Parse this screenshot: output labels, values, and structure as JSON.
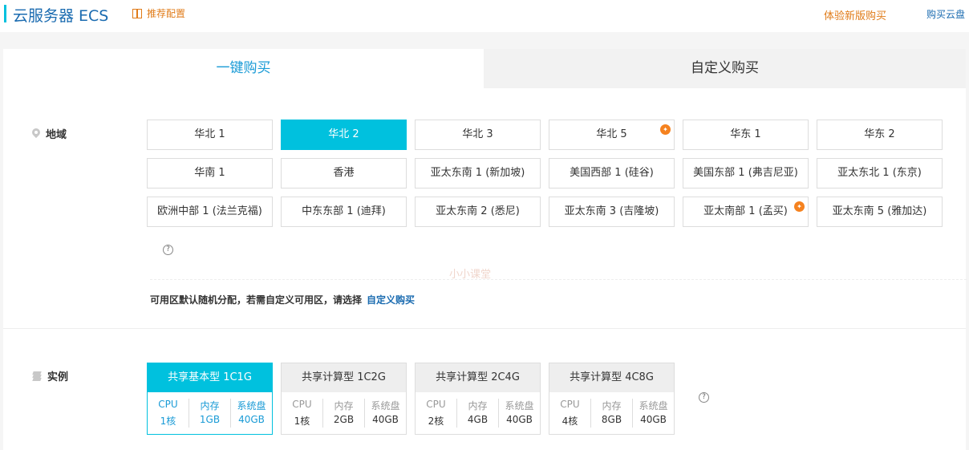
{
  "header": {
    "title": "云服务器 ECS",
    "recommend_label": "推荐配置",
    "new_version_link": "体验新版购买",
    "buy_disk_link": "购买云盘"
  },
  "tabs": [
    {
      "label": "一键购买",
      "active": true
    },
    {
      "label": "自定义购买",
      "active": false
    }
  ],
  "region": {
    "label": "地域",
    "options": [
      {
        "label": "华北 1"
      },
      {
        "label": "华北 2",
        "selected": true
      },
      {
        "label": "华北 3"
      },
      {
        "label": "华北 5",
        "badge": "new"
      },
      {
        "label": "华东 1"
      },
      {
        "label": "华东 2"
      },
      {
        "label": "华南 1"
      },
      {
        "label": "香港"
      },
      {
        "label": "亚太东南 1 (新加坡)"
      },
      {
        "label": "美国西部 1 (硅谷)"
      },
      {
        "label": "美国东部 1 (弗吉尼亚)"
      },
      {
        "label": "亚太东北 1 (东京)"
      },
      {
        "label": "欧洲中部 1 (法兰克福)"
      },
      {
        "label": "中东东部 1 (迪拜)"
      },
      {
        "label": "亚太东南 2 (悉尼)"
      },
      {
        "label": "亚太东南 3 (吉隆坡)"
      },
      {
        "label": "亚太南部 1 (孟买)",
        "badge": "new"
      },
      {
        "label": "亚太东南 5 (雅加达)"
      }
    ],
    "help_icon": "question-circle-icon",
    "zone_note": "可用区默认随机分配，若需自定义可用区，请选择",
    "zone_link": "自定义购买"
  },
  "instance": {
    "label": "实例",
    "options": [
      {
        "title": "共享基本型 1C1G",
        "selected": true,
        "specs": [
          {
            "k": "CPU",
            "v": "1核"
          },
          {
            "k": "内存",
            "v": "1GB"
          },
          {
            "k": "系统盘",
            "v": "40GB"
          }
        ]
      },
      {
        "title": "共享计算型 1C2G",
        "specs": [
          {
            "k": "CPU",
            "v": "1核"
          },
          {
            "k": "内存",
            "v": "2GB"
          },
          {
            "k": "系统盘",
            "v": "40GB"
          }
        ]
      },
      {
        "title": "共享计算型 2C4G",
        "specs": [
          {
            "k": "CPU",
            "v": "2核"
          },
          {
            "k": "内存",
            "v": "4GB"
          },
          {
            "k": "系统盘",
            "v": "40GB"
          }
        ]
      },
      {
        "title": "共享计算型 4C8G",
        "specs": [
          {
            "k": "CPU",
            "v": "4核"
          },
          {
            "k": "内存",
            "v": "8GB"
          },
          {
            "k": "系统盘",
            "v": "40GB"
          }
        ]
      }
    ]
  },
  "watermark": "小小课堂",
  "colors": {
    "accent": "#00c1de",
    "link": "#1a6bb0",
    "orange": "#e07b18"
  }
}
